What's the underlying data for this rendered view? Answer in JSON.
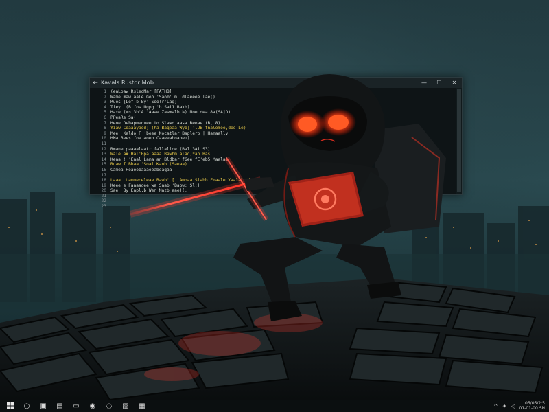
{
  "window": {
    "title": "Kavals Rustor Mob",
    "back_glyph": "←",
    "minimize_glyph": "—",
    "maximize_glyph": "☐",
    "close_glyph": "✕"
  },
  "editor": {
    "line_numbers": [
      "1",
      "2",
      "3",
      "4",
      "5",
      "6",
      "7",
      "8",
      "9",
      "10",
      "11",
      "12",
      "13",
      "14",
      "15",
      "16",
      "17",
      "18",
      "19",
      "20",
      "21",
      "22",
      "23"
    ],
    "lines": [
      "(eaLoaw RsleoMar [FATHB]",
      "Wame mawlaale Goo 'Saom' ml dlaeeee lae()",
      "Rues [Lef'b Ey' Soolr'Lag]",
      "Tfey  (B fow Ugpg 'b Sa11 Bakb)",
      "Haxe (<~ 3b'A 'Aaae Zawmalb %) Noe dea 8a(SA]D)",
      "PPeaRe Sa(",
      "Heoe Debapmeduee to Slawd aasa Beoae (B, 8)",
      "Yiaw Cdaaayaod] (ha Baqeaa Wyb] 'lUB fnalomoe,doo Le)",
      "Mee  Kaldo F 'beee Nocatlar Baplerb | Hamaallv",
      "HMa Bees foe aoeb Caaeeaboaoeu)",
      "",
      "Rmane paaaalaatr fallalloe (Bal 3A1 S3)",
      "Wale a# Hal'Bpalaaaa Bawbmlalad)*ab Bas",
      "Keaa ! 'Eaal Lama an Bldbar f6ee fE'eb5 Maala)",
      "Ruaw f Bbaa 'Soal Kaob (Saeaa)",
      "Camea Hoaeobaaaoeaboaqaa",
      "",
      "Laaa  Uammeceleae Bawb' [ 'Amoaa Slabb Fmaale Yaalala:]",
      "Keee e Faaaadee wa Saab 'Babw: Sl:)",
      "Sae  By Eapl.b Wen Mazb aae)(;",
      "",
      "",
      ""
    ]
  },
  "taskbar": {
    "start_icon": "windows-logo-icon",
    "items": [
      {
        "name": "search-icon",
        "glyph": "○"
      },
      {
        "name": "task-view-icon",
        "glyph": "▣"
      },
      {
        "name": "store-icon",
        "glyph": "▤"
      },
      {
        "name": "file-explorer-icon",
        "glyph": "▭"
      },
      {
        "name": "browser-icon",
        "glyph": "◉"
      },
      {
        "name": "chat-icon",
        "glyph": "◌"
      },
      {
        "name": "terminal-icon",
        "glyph": "▧"
      },
      {
        "name": "apps-icon",
        "glyph": "▦"
      }
    ],
    "tray": {
      "chevron_glyph": "^",
      "network_glyph": "✦",
      "volume_glyph": "◁",
      "clock_time": "05/05/2:5",
      "clock_date": "01-01-00 SN"
    }
  },
  "colors": {
    "sky_top": "#243c42",
    "sky_bottom": "#0f2226",
    "saber_red": "#ff3a2e",
    "eye_glow": "#ff4a1c",
    "code_yellow": "#e6c84a",
    "code_red": "#e0403a"
  }
}
